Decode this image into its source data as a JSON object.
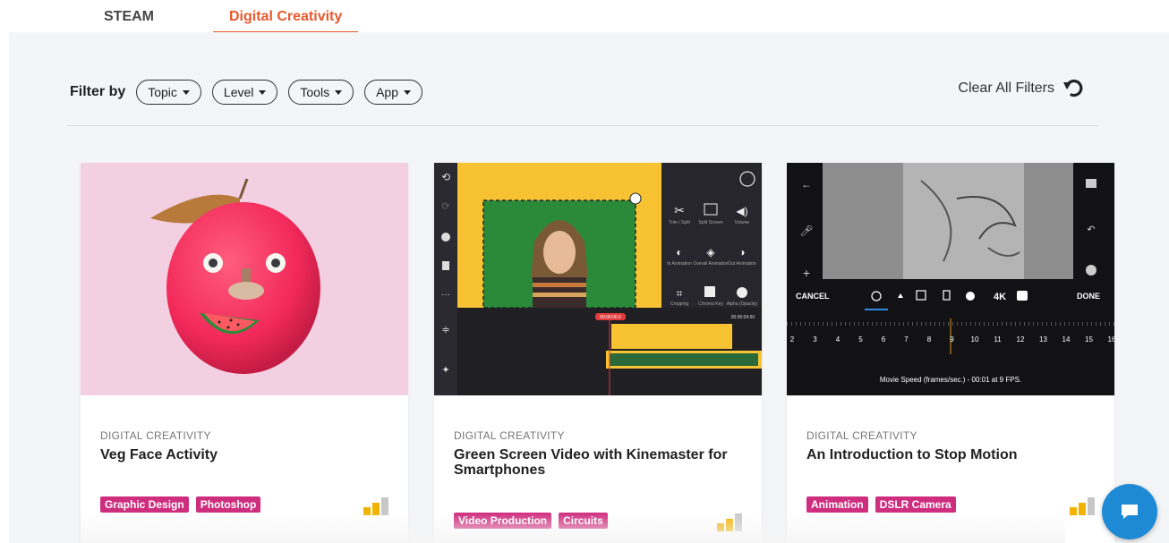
{
  "tabs": [
    {
      "label": "STEAM",
      "active": false
    },
    {
      "label": "Digital Creativity",
      "active": true
    }
  ],
  "filter": {
    "label": "Filter by",
    "options": [
      "Topic",
      "Level",
      "Tools",
      "App"
    ],
    "clear_label": "Clear All Filters"
  },
  "cards": [
    {
      "category": "DIGITAL CREATIVITY",
      "title": "Veg Face Activity",
      "tags": [
        "Graphic Design",
        "Photoshop"
      ],
      "level": "2 of 3"
    },
    {
      "category": "DIGITAL CREATIVITY",
      "title": "Green Screen Video with Kinemaster for Smartphones",
      "tags": [
        "Video Production",
        "Circuits"
      ],
      "level": "2 of 3",
      "thumb": {
        "tools": [
          "Trim / Split",
          "Split Screen",
          "Volume",
          "In Animation",
          "Overall Animation",
          "Out Animation",
          "Cropping",
          "Chroma Key",
          "Alpha (Opacity)"
        ],
        "time_start": "00:00:00.0",
        "time_end": "00:00:04.50"
      }
    },
    {
      "category": "DIGITAL CREATIVITY",
      "title": "An Introduction to Stop Motion",
      "tags": [
        "Animation",
        "DSLR Camera"
      ],
      "level": "2 of 3",
      "thumb": {
        "cancel": "CANCEL",
        "done": "DONE",
        "quality": "4K",
        "scale": [
          "2",
          "3",
          "4",
          "5",
          "6",
          "7",
          "8",
          "9",
          "10",
          "11",
          "12",
          "13",
          "14",
          "15",
          "16"
        ],
        "speed_caption": "Movie Speed (frames/sec.) - 00:01 at 9 FPS."
      }
    }
  ],
  "colors": {
    "accent": "#e8582d",
    "tag": "#cf2e7f",
    "level_on": "#f1b200",
    "level_off": "#c7c7c7",
    "chat": "#1e8ad6"
  },
  "icons": {
    "clear": "undo-icon",
    "chat": "chat-icon"
  }
}
